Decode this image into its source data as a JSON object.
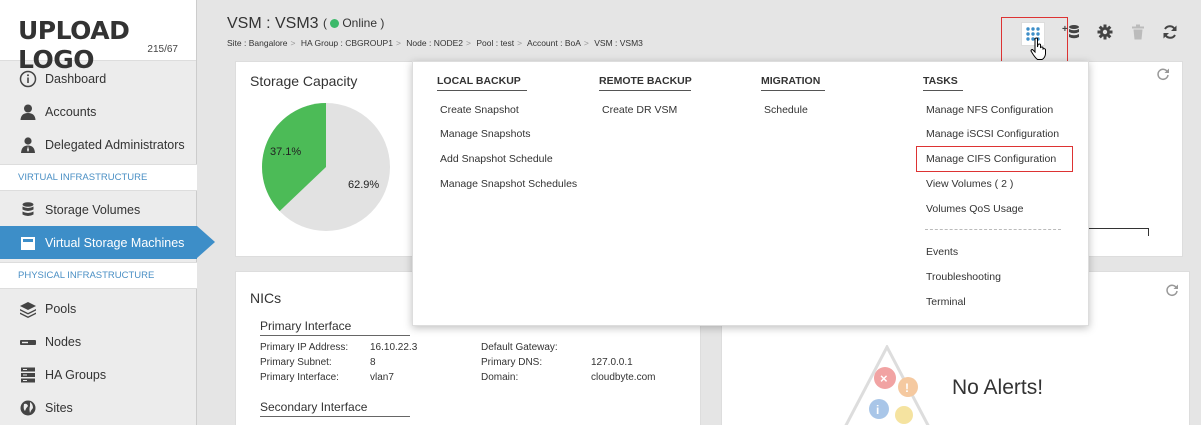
{
  "logo": {
    "text": "UPLOAD LOGO",
    "size": "215/67"
  },
  "sidebar": {
    "items": [
      {
        "label": "Dashboard",
        "icon": "info-icon"
      },
      {
        "label": "Accounts",
        "icon": "user-icon"
      },
      {
        "label": "Delegated Administrators",
        "icon": "admin-user-icon"
      },
      {
        "label": "Storage Volumes",
        "icon": "database-icon"
      },
      {
        "label": "Virtual Storage Machines",
        "icon": "virtual-machine-icon"
      },
      {
        "label": "Pools",
        "icon": "layers-icon"
      },
      {
        "label": "Nodes",
        "icon": "node-icon"
      },
      {
        "label": "HA Groups",
        "icon": "server-icon"
      },
      {
        "label": "Sites",
        "icon": "globe-icon"
      }
    ],
    "sections": {
      "virtual": "VIRTUAL INFRASTRUCTURE",
      "physical": "PHYSICAL INFRASTRUCTURE"
    }
  },
  "header": {
    "title": "VSM : VSM3",
    "status_open": "(",
    "status": "Online",
    "status_close": ")",
    "breadcrumb": [
      "Site : Bangalore",
      "HA Group : CBGROUP1",
      "Node : NODE2",
      "Pool : test",
      "Account : BoA",
      "VSM : VSM3"
    ],
    "status_color": "#3cb96a"
  },
  "toolbar": {
    "icons": [
      "apps-grid-icon",
      "add-storage-icon",
      "gear-icon",
      "trash-icon",
      "refresh-icon"
    ]
  },
  "storage": {
    "title": "Storage Capacity",
    "used_pct": 37.1,
    "free_pct": 62.9,
    "used_label": "37.1%",
    "free_label": "62.9%",
    "used_color": "#4cbb57",
    "free_color": "#e2e2e2"
  },
  "menu": {
    "local_backup": {
      "title": "LOCAL BACKUP",
      "items": [
        "Create Snapshot",
        "Manage Snapshots",
        "Add Snapshot Schedule",
        "Manage Snapshot Schedules"
      ]
    },
    "remote_backup": {
      "title": "REMOTE BACKUP",
      "items": [
        "Create DR VSM"
      ]
    },
    "migration": {
      "title": "MIGRATION",
      "items": [
        "Schedule"
      ]
    },
    "tasks": {
      "title": "TASKS",
      "items": [
        "Manage NFS Configuration",
        "Manage iSCSI Configuration",
        "Manage CIFS Configuration",
        "View Volumes ( 2 )",
        "Volumes QoS Usage"
      ],
      "extra": [
        "Events",
        "Troubleshooting",
        "Terminal"
      ]
    }
  },
  "nics": {
    "title": "NICs",
    "primary_title": "Primary Interface",
    "secondary_title": "Secondary Interface",
    "primary": [
      {
        "label": "Primary IP Address:",
        "value": "16.10.22.3"
      },
      {
        "label": "Primary Subnet:",
        "value": "8"
      },
      {
        "label": "Primary Interface:",
        "value": "vlan7"
      }
    ],
    "gateway": [
      {
        "label": "Default Gateway:",
        "value": ""
      },
      {
        "label": "Primary DNS:",
        "value": "127.0.0.1"
      },
      {
        "label": "Domain:",
        "value": "cloudbyte.com"
      }
    ]
  },
  "alerts": {
    "text": "No Alerts!"
  }
}
